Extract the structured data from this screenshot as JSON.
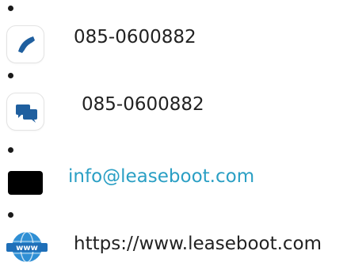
{
  "contacts": [
    {
      "type": "phone",
      "icon": "phone-icon",
      "text": "085-0600882"
    },
    {
      "type": "chat",
      "icon": "chat-icon",
      "text": "085-0600882"
    },
    {
      "type": "email",
      "icon": "mail-icon",
      "text": "info@leaseboot.com"
    },
    {
      "type": "website",
      "icon": "globe-icon",
      "icon_text": "www",
      "text": "https://www.leaseboot.com"
    }
  ],
  "colors": {
    "accent_blue": "#1f5f9f",
    "link": "#2a9fc4",
    "text": "#222222"
  }
}
